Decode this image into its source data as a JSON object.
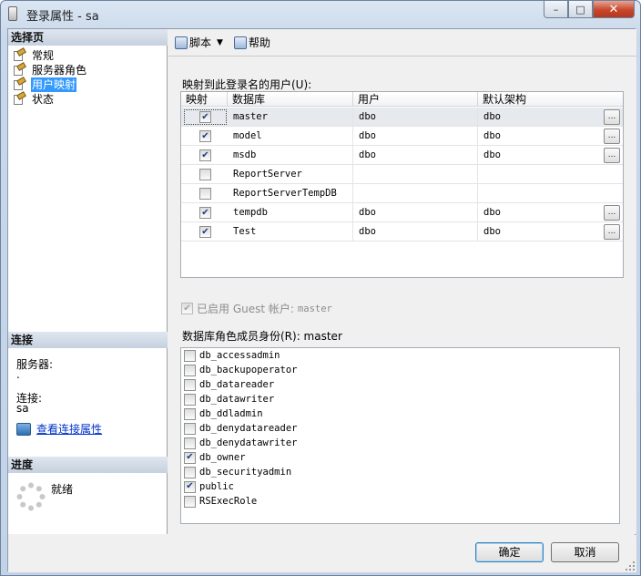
{
  "window": {
    "title": "登录属性 - sa",
    "minimize": "–",
    "maximize": "□",
    "close": "✕"
  },
  "left": {
    "select_page_header": "选择页",
    "pages": [
      {
        "label": "常规",
        "icon": "page-settings-icon"
      },
      {
        "label": "服务器角色",
        "icon": "page-settings-icon"
      },
      {
        "label": "用户映射",
        "icon": "page-settings-icon",
        "selected": true
      },
      {
        "label": "状态",
        "icon": "page-settings-icon"
      }
    ],
    "connection_header": "连接",
    "server_label": "服务器:",
    "server_value": ".",
    "connection_label": "连接:",
    "connection_value": "sa",
    "view_connection_link": "查看连接属性",
    "progress_header": "进度",
    "progress_status": "就绪"
  },
  "toolbar": {
    "script_label": "脚本",
    "help_label": "帮助"
  },
  "mapping": {
    "label": "映射到此登录名的用户(U):",
    "columns": [
      "映射",
      "数据库",
      "用户",
      "默认架构"
    ],
    "rows": [
      {
        "mapped": true,
        "database": "master",
        "user": "dbo",
        "schema": "dbo",
        "browse": "..."
      },
      {
        "mapped": true,
        "database": "model",
        "user": "dbo",
        "schema": "dbo",
        "browse": "..."
      },
      {
        "mapped": true,
        "database": "msdb",
        "user": "dbo",
        "schema": "dbo",
        "browse": "..."
      },
      {
        "mapped": false,
        "database": "ReportServer",
        "user": "",
        "schema": "",
        "browse": ""
      },
      {
        "mapped": false,
        "database": "ReportServerTempDB",
        "user": "",
        "schema": "",
        "browse": ""
      },
      {
        "mapped": true,
        "database": "tempdb",
        "user": "dbo",
        "schema": "dbo",
        "browse": "..."
      },
      {
        "mapped": true,
        "database": "Test",
        "user": "dbo",
        "schema": "dbo",
        "browse": "..."
      }
    ]
  },
  "guest": {
    "checked": true,
    "label": "已启用 Guest 帐户:",
    "database": "master"
  },
  "roles": {
    "label": "数据库角色成员身份(R): master",
    "items": [
      {
        "name": "db_accessadmin",
        "checked": false
      },
      {
        "name": "db_backupoperator",
        "checked": false
      },
      {
        "name": "db_datareader",
        "checked": false
      },
      {
        "name": "db_datawriter",
        "checked": false
      },
      {
        "name": "db_ddladmin",
        "checked": false
      },
      {
        "name": "db_denydatareader",
        "checked": false
      },
      {
        "name": "db_denydatawriter",
        "checked": false
      },
      {
        "name": "db_owner",
        "checked": true
      },
      {
        "name": "db_securityadmin",
        "checked": false
      },
      {
        "name": "public",
        "checked": true
      },
      {
        "name": "RSExecRole",
        "checked": false
      }
    ]
  },
  "footer": {
    "ok_label": "确定",
    "cancel_label": "取消"
  },
  "colors": {
    "selection": "#3399ff",
    "link": "#0033cc",
    "check": "#1b3e83",
    "close_button": "#c7472a"
  }
}
